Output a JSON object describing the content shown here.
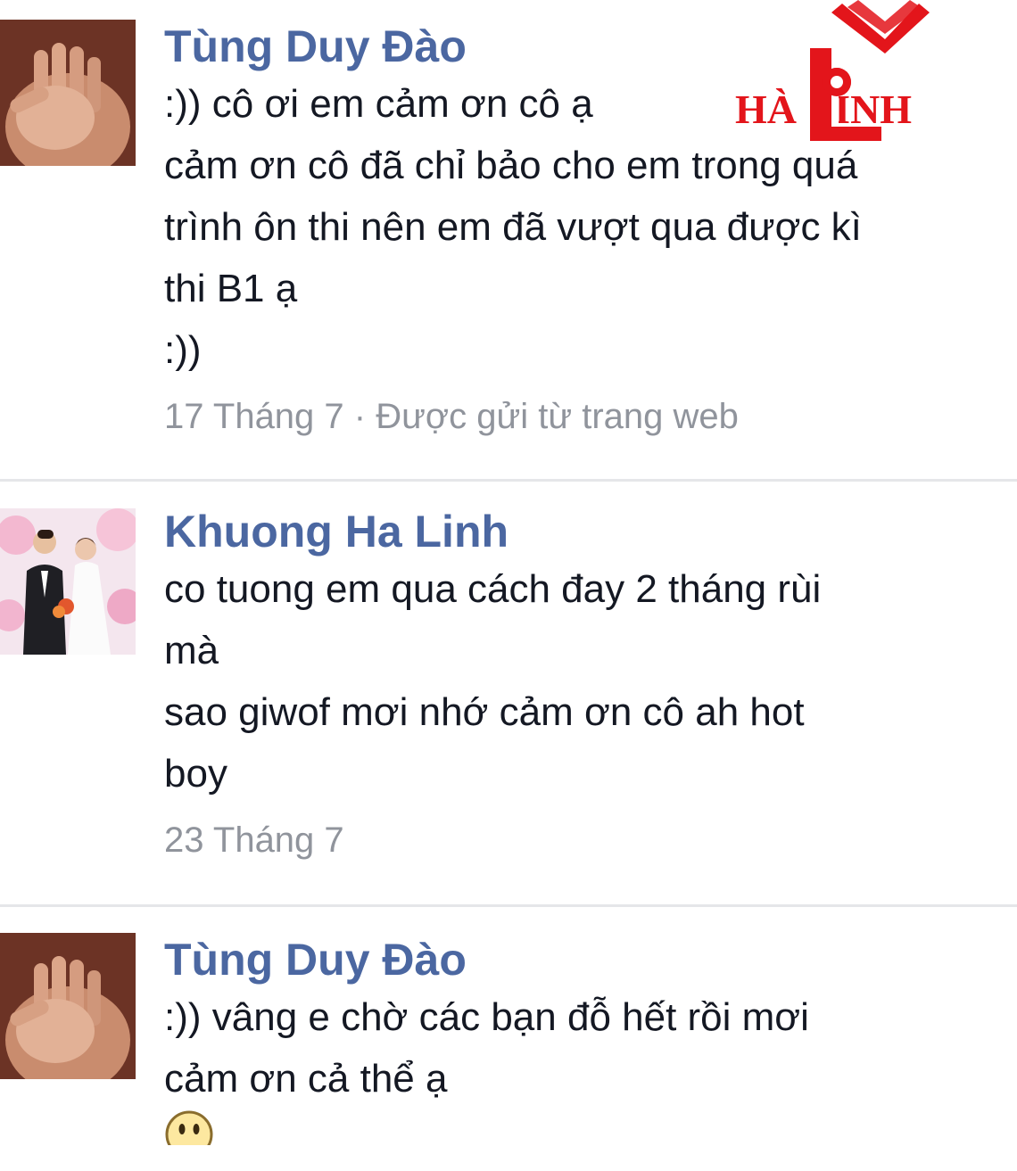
{
  "thread": {
    "messages": [
      {
        "sender": "Tùng Duy Đào",
        "lines": [
          ":)) cô ơi em cảm ơn cô ạ",
          "cảm ơn cô đã chỉ bảo cho em trong quá",
          "trình ôn thi nên em đã vượt qua được kì",
          "thi B1 ạ",
          ":))"
        ],
        "timestamp": "17 Tháng 7 · Được gửi từ trang web"
      },
      {
        "sender": "Khuong Ha Linh",
        "lines": [
          "co tuong em qua cách đay 2 tháng rùi",
          "mà",
          "sao giwof mơi nhớ cảm ơn cô ah hot",
          "boy"
        ],
        "timestamp": "23 Tháng 7"
      },
      {
        "sender": "Tùng Duy Đào",
        "lines": [
          ":)) vâng e chờ các bạn đỗ hết rồi mơi",
          "cảm ơn cả thể ạ"
        ],
        "emoji_icon": "smiley-face-icon"
      }
    ]
  },
  "logo": {
    "text": "HÀ LINH",
    "color": "#e3151b"
  },
  "colors": {
    "sender": "#4b67a1",
    "text": "#141823",
    "meta": "#90949c",
    "divider": "#e5e6e9"
  }
}
